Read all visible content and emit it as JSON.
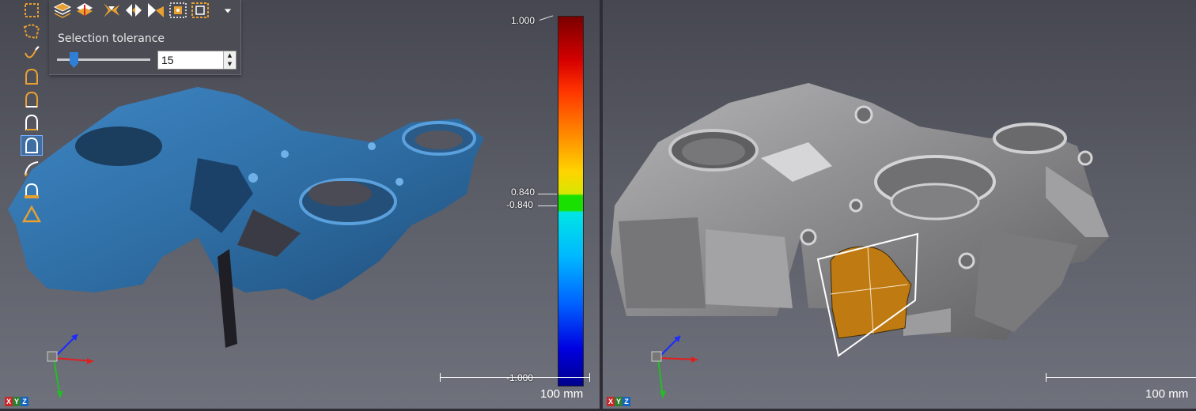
{
  "panel": {
    "tolerance_label": "Selection tolerance",
    "tolerance_value": "15",
    "slider_level_percent": 15,
    "tools": [
      "layers-up-icon",
      "layers-down-icon",
      "grow-selection-icon",
      "shrink-selection-icon",
      "expand-selection-icon",
      "select-region-icon",
      "select-boundary-icon",
      "dropdown-arrow-icon"
    ]
  },
  "vertical_tools": [
    "rectangle-select-icon",
    "polygon-select-icon",
    "lasso-select-icon",
    "arch-select-1-icon",
    "arch-select-2-icon",
    "arch-select-3-icon",
    "arch-select-4-icon",
    "curve-select-icon",
    "arch-handle-select-icon",
    "triangle-select-icon"
  ],
  "color_scale": {
    "max_label": "1.000",
    "upper_tol_label": "0.840",
    "lower_tol_label": "-0.840",
    "min_label": "-1.000",
    "colors": {
      "max": "#7a0000",
      "tolerance": "#19e000",
      "min": "#00008c"
    }
  },
  "left_view": {
    "scale_text": "100 mm",
    "xyz": [
      "X",
      "Y",
      "Z"
    ]
  },
  "right_view": {
    "scale_text": "100 mm",
    "xyz": [
      "X",
      "Y",
      "Z"
    ]
  },
  "colors": {
    "scan_mesh": "#2f6fa6",
    "cad_model": "#8d8d8f",
    "selection_face": "#c07a12",
    "active_tool": "#3f6ea3"
  }
}
